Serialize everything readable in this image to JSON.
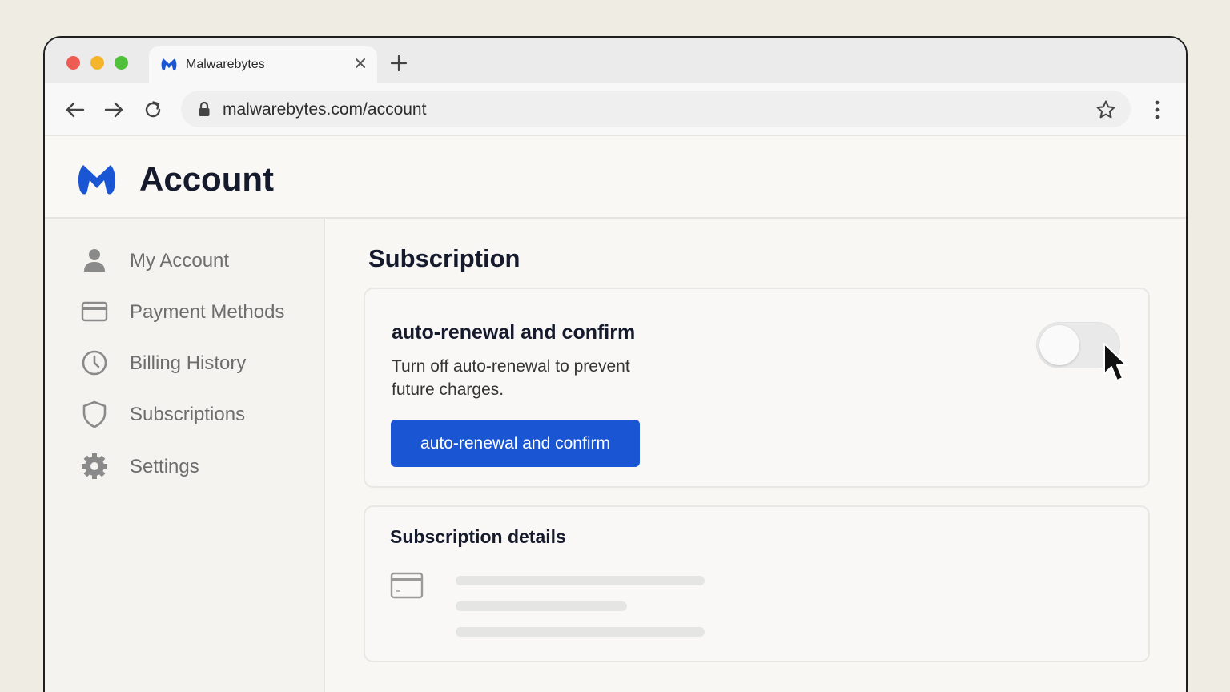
{
  "browser": {
    "tab_title": "Malwarebytes",
    "url": "malwarebytes.com/account",
    "icons": {
      "back": "arrow-left-icon",
      "forward": "arrow-right-icon",
      "reload": "reload-icon",
      "lock": "lock-icon",
      "bookmark": "star-icon",
      "menu": "kebab-menu-icon",
      "new_tab": "plus-icon",
      "close_tab": "close-icon"
    }
  },
  "header": {
    "title": "Account",
    "brand_color": "#1a56d4"
  },
  "sidebar": {
    "items": [
      {
        "label": "My Account",
        "icon": "user-icon"
      },
      {
        "label": "Payment Methods",
        "icon": "credit-card-icon"
      },
      {
        "label": "Billing History",
        "icon": "clock-icon"
      },
      {
        "label": "Subscriptions",
        "icon": "shield-icon"
      },
      {
        "label": "Settings",
        "icon": "gear-icon"
      }
    ]
  },
  "main": {
    "title": "Subscription",
    "renewal_card": {
      "heading": "auto-renewal and confirm",
      "description": "Turn off auto-renewal to prevent future charges.",
      "button_label": "auto-renewal and confirm",
      "toggle_on": false
    },
    "details_card": {
      "heading": "Subscription details",
      "icon": "credit-card-icon"
    }
  }
}
